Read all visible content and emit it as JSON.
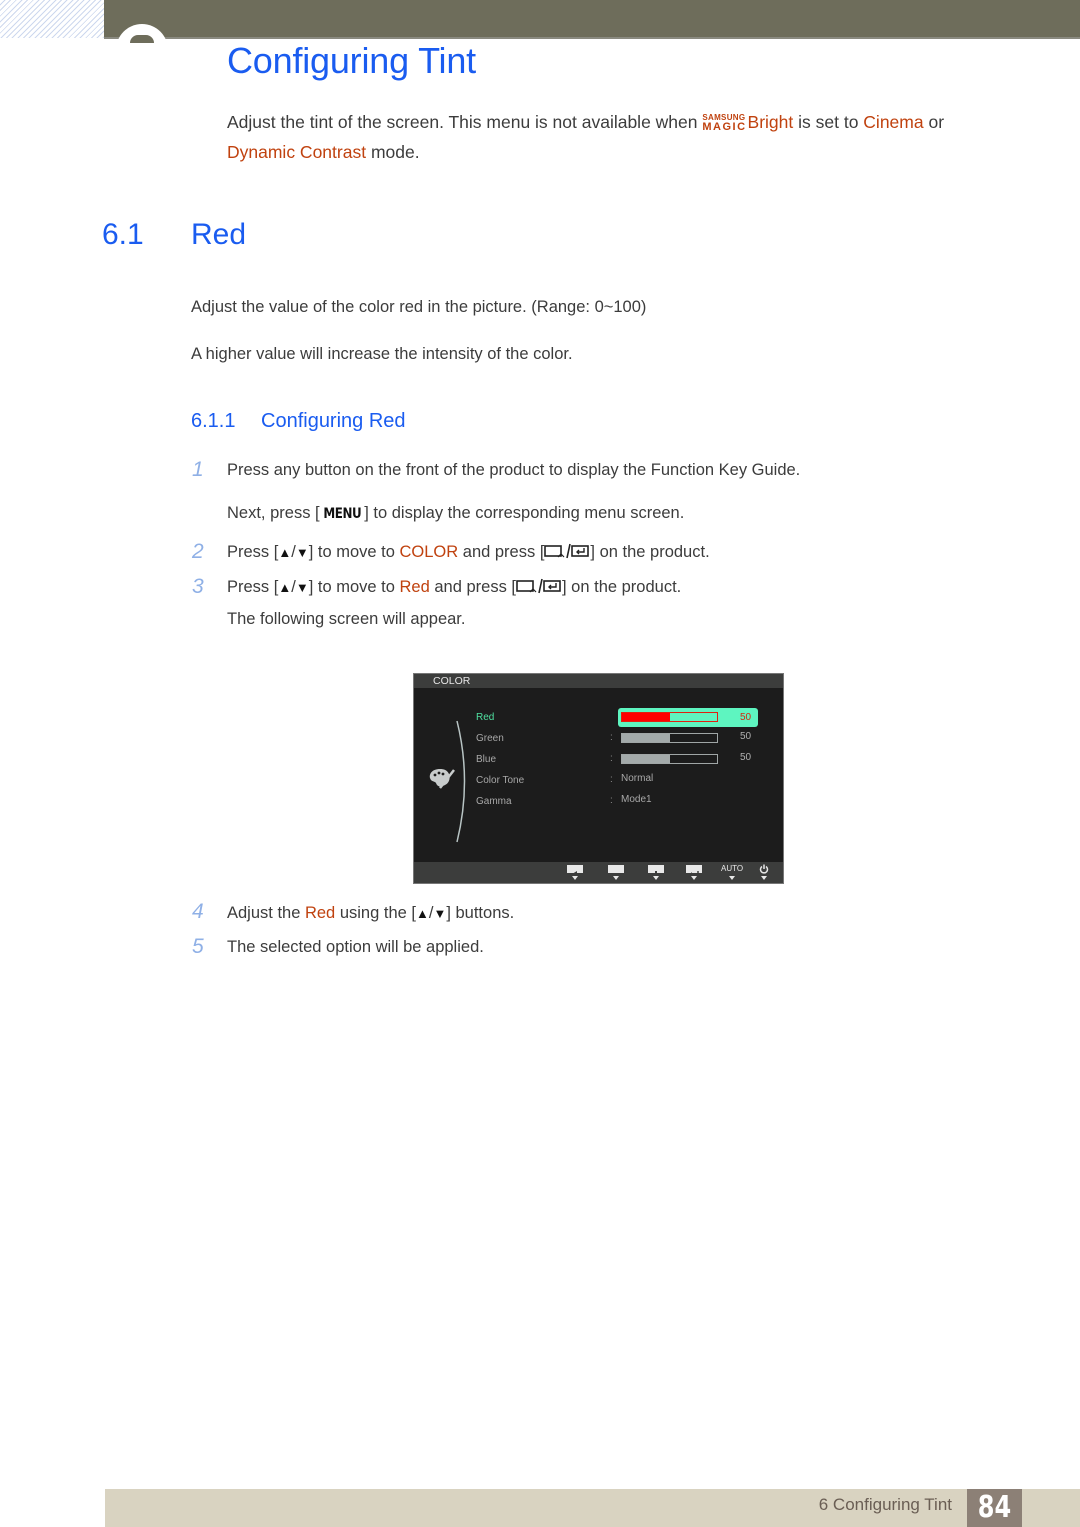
{
  "header": {
    "chapter_title": "Configuring Tint"
  },
  "intro": {
    "text_1": "Adjust the tint of the screen. This menu is not available when ",
    "magic_top": "SAMSUNG",
    "magic_bottom": "MAGIC",
    "bright": "Bright",
    "text_2": " is set to ",
    "cinema": "Cinema",
    "text_3": " or",
    "dynamic_contrast": "Dynamic Contrast",
    "text_4": " mode."
  },
  "section": {
    "number": "6.1",
    "title": "Red",
    "para_1": "Adjust the value of the color red in the picture. (Range: 0~100)",
    "para_2": "A higher value will increase the intensity of the color."
  },
  "subsection": {
    "number": "6.1.1",
    "title": "Configuring Red"
  },
  "steps": [
    {
      "num": "1",
      "text": "Press any button on the front of the product to display the Function Key Guide."
    },
    {
      "num": "",
      "pre": "Next, press [",
      "key": "MENU",
      "post": "] to display the corresponding menu screen."
    },
    {
      "num": "2",
      "pre": "Press [",
      "up": "▲",
      "slash": "/",
      "down": "▼",
      "mid": "] to move to ",
      "target": "COLOR",
      "mid2": " and press [",
      "post": "] on the product."
    },
    {
      "num": "3",
      "pre": "Press [",
      "up": "▲",
      "slash": "/",
      "down": "▼",
      "mid": "] to move to ",
      "target": "Red",
      "mid2": " and press [",
      "post": "] on the product."
    },
    {
      "num": "",
      "text": "The following screen will appear."
    },
    {
      "num": "4",
      "pre": "Adjust the ",
      "target": "Red",
      "mid": " using the [",
      "up": "▲",
      "slash": "/",
      "down": "▼",
      "post": "] buttons."
    },
    {
      "num": "5",
      "text": "The selected option will be applied."
    }
  ],
  "osd": {
    "title": "COLOR",
    "items": [
      {
        "label": "Red",
        "type": "bar",
        "value": "50",
        "percent": 50,
        "selected": true
      },
      {
        "label": "Green",
        "type": "bar",
        "value": "50",
        "percent": 50,
        "selected": false
      },
      {
        "label": "Blue",
        "type": "bar",
        "value": "50",
        "percent": 50,
        "selected": false
      },
      {
        "label": "Color Tone",
        "type": "text",
        "value": "Normal",
        "selected": false
      },
      {
        "label": "Gamma",
        "type": "text",
        "value": "Mode1",
        "selected": false
      }
    ],
    "colon": ":",
    "footer_keys": [
      "left-key",
      "minus-key",
      "plus-key",
      "enter-key",
      "AUTO",
      "power-key"
    ],
    "auto_label": "AUTO"
  },
  "footer": {
    "label": "6 Configuring Tint",
    "page": "84"
  }
}
